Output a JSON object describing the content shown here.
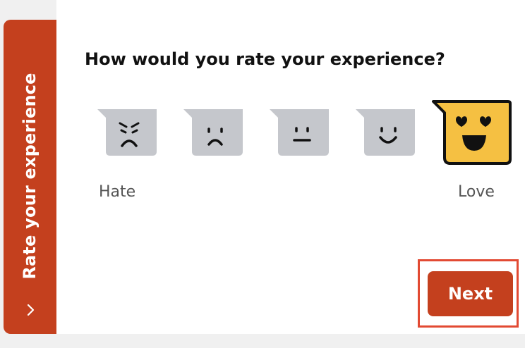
{
  "side_tab": {
    "label": "Rate your experience",
    "chevron_icon": "chevron-right-icon"
  },
  "question": "How would you rate your experience?",
  "scale": {
    "low_label": "Hate",
    "high_label": "Love",
    "selected": "love",
    "faces": [
      {
        "id": "hate",
        "icon": "angry-face-icon"
      },
      {
        "id": "dislike",
        "icon": "sad-face-icon"
      },
      {
        "id": "neutral",
        "icon": "neutral-face-icon"
      },
      {
        "id": "like",
        "icon": "smile-face-icon"
      },
      {
        "id": "love",
        "icon": "heart-eyes-face-icon"
      }
    ]
  },
  "next_button": {
    "label": "Next"
  },
  "colors": {
    "accent": "#c4401e",
    "face_default": "#c5c7cc",
    "face_selected": "#f5c042",
    "highlight": "#e24a33"
  }
}
